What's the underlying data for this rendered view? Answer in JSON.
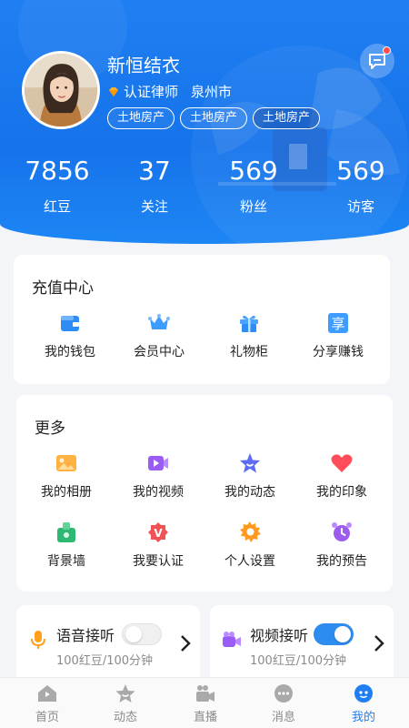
{
  "profile": {
    "name": "新恒结衣",
    "certification": "认证律师",
    "city": "泉州市",
    "tags": [
      "土地房产",
      "土地房产",
      "土地房产"
    ]
  },
  "stats": [
    {
      "value": "7856",
      "label": "红豆"
    },
    {
      "value": "37",
      "label": "关注"
    },
    {
      "value": "569",
      "label": "粉丝"
    },
    {
      "value": "569",
      "label": "访客"
    }
  ],
  "recharge": {
    "title": "充值中心",
    "items": [
      {
        "label": "我的钱包",
        "icon": "wallet-icon"
      },
      {
        "label": "会员中心",
        "icon": "crown-icon"
      },
      {
        "label": "礼物柜",
        "icon": "gift-icon"
      },
      {
        "label": "分享赚钱",
        "icon": "share-icon",
        "glyph": "享"
      }
    ]
  },
  "more": {
    "title": "更多",
    "items": [
      {
        "label": "我的相册",
        "icon": "album-icon"
      },
      {
        "label": "我的视频",
        "icon": "video-icon"
      },
      {
        "label": "我的动态",
        "icon": "star-icon"
      },
      {
        "label": "我的印象",
        "icon": "heart-icon"
      },
      {
        "label": "背景墙",
        "icon": "background-wall-icon"
      },
      {
        "label": "我要认证",
        "icon": "verify-icon",
        "glyph": "V"
      },
      {
        "label": "个人设置",
        "icon": "gear-icon"
      },
      {
        "label": "我的预告",
        "icon": "alarm-clock-icon"
      }
    ]
  },
  "receive": {
    "voice": {
      "label": "语音接听",
      "price": "100红豆/100分钟",
      "enabled": false
    },
    "video": {
      "label": "视频接听",
      "price": "100红豆/100分钟",
      "enabled": true
    }
  },
  "tabs": [
    {
      "label": "首页",
      "icon": "home-icon"
    },
    {
      "label": "动态",
      "icon": "moments-icon"
    },
    {
      "label": "直播",
      "icon": "live-icon"
    },
    {
      "label": "消息",
      "icon": "message-icon"
    },
    {
      "label": "我的",
      "icon": "profile-icon",
      "active": true
    }
  ],
  "colors": {
    "primary": "#1f7ff2",
    "header_bg": "#1673ea",
    "notification": "#ff4d4f",
    "toggle_on": "#2d8cf0"
  }
}
